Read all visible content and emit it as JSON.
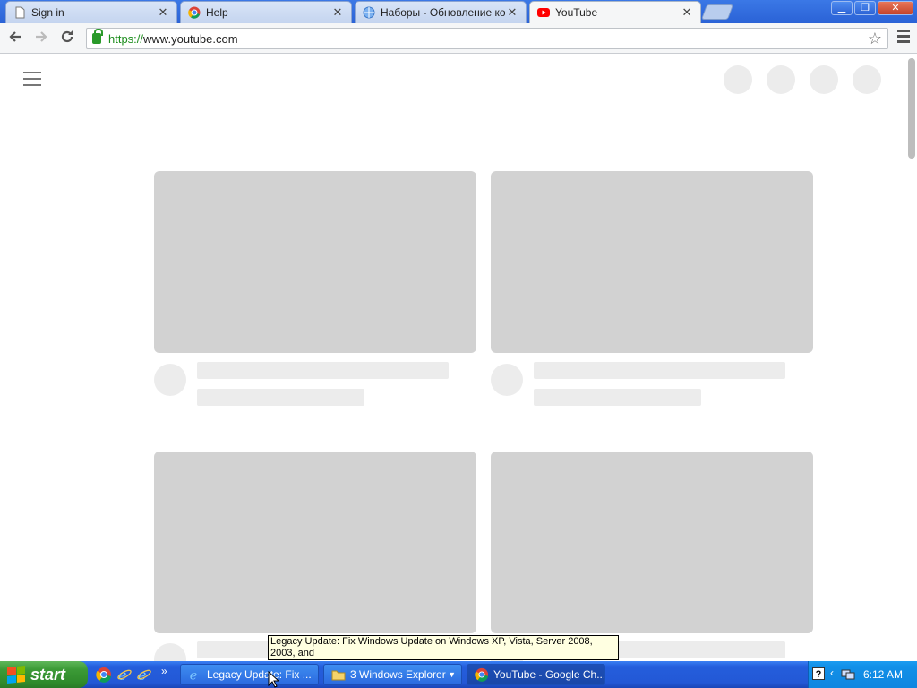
{
  "browser": {
    "tabs": [
      {
        "label": "Sign in",
        "icon": "document-icon"
      },
      {
        "label": "Help",
        "icon": "chrome-icon"
      },
      {
        "label": "Наборы - Обновление корн",
        "icon": "globe-icon"
      },
      {
        "label": "YouTube",
        "icon": "youtube-icon",
        "active": true
      }
    ],
    "close_glyph": "✕",
    "url_scheme": "https://",
    "url_rest": "www.youtube.com",
    "colors": {
      "titlebar": "#2a62d6",
      "ssl_green": "#1e8e1e",
      "youtube_red": "#ff0000"
    }
  },
  "tooltip": {
    "text": "Legacy Update: Fix Windows Update on Windows XP, Vista, Server 2008, 2003, and"
  },
  "taskbar": {
    "start_label": "start",
    "quick_launch": [
      "chrome-icon",
      "ie-icon",
      "ie-icon"
    ],
    "chevron": "»",
    "buttons": [
      {
        "label": "Legacy Update: Fix ...",
        "icon": "ie-icon"
      },
      {
        "label": "3 Windows Explorer",
        "icon": "folder-icon"
      },
      {
        "label": "YouTube - Google Ch...",
        "icon": "chrome-icon",
        "pressed": true
      }
    ],
    "clock": "6:12 AM"
  }
}
